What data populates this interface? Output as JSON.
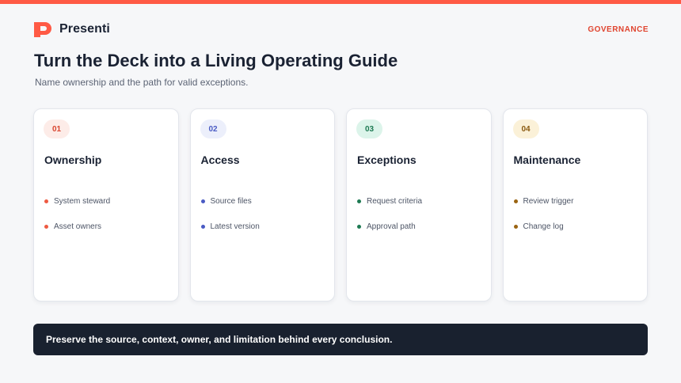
{
  "brand": {
    "name": "Presenti",
    "accent": "#ff5a45"
  },
  "header": {
    "section_tag": "GOVERNANCE"
  },
  "slide": {
    "title": "Turn the Deck into a Living Operating Guide",
    "subtitle": "Name ownership and the path for valid exceptions."
  },
  "cards": [
    {
      "number": "01",
      "title": "Ownership",
      "badge_bg": "#fdece8",
      "badge_color": "#d9452f",
      "dot_color": "#ee5a42",
      "items": [
        "System steward",
        "Asset owners"
      ]
    },
    {
      "number": "02",
      "title": "Access",
      "badge_bg": "#eceffb",
      "badge_color": "#4a5bc4",
      "dot_color": "#4a5bc4",
      "items": [
        "Source files",
        "Latest version"
      ]
    },
    {
      "number": "03",
      "title": "Exceptions",
      "badge_bg": "#dcf4ea",
      "badge_color": "#1e7a53",
      "dot_color": "#1e7a53",
      "items": [
        "Request criteria",
        "Approval path"
      ]
    },
    {
      "number": "04",
      "title": "Maintenance",
      "badge_bg": "#fbf1d8",
      "badge_color": "#8a5a10",
      "dot_color": "#9a6412",
      "items": [
        "Review trigger",
        "Change log"
      ]
    }
  ],
  "footer": {
    "text": "Preserve the source, context, owner, and limitation behind every conclusion."
  }
}
